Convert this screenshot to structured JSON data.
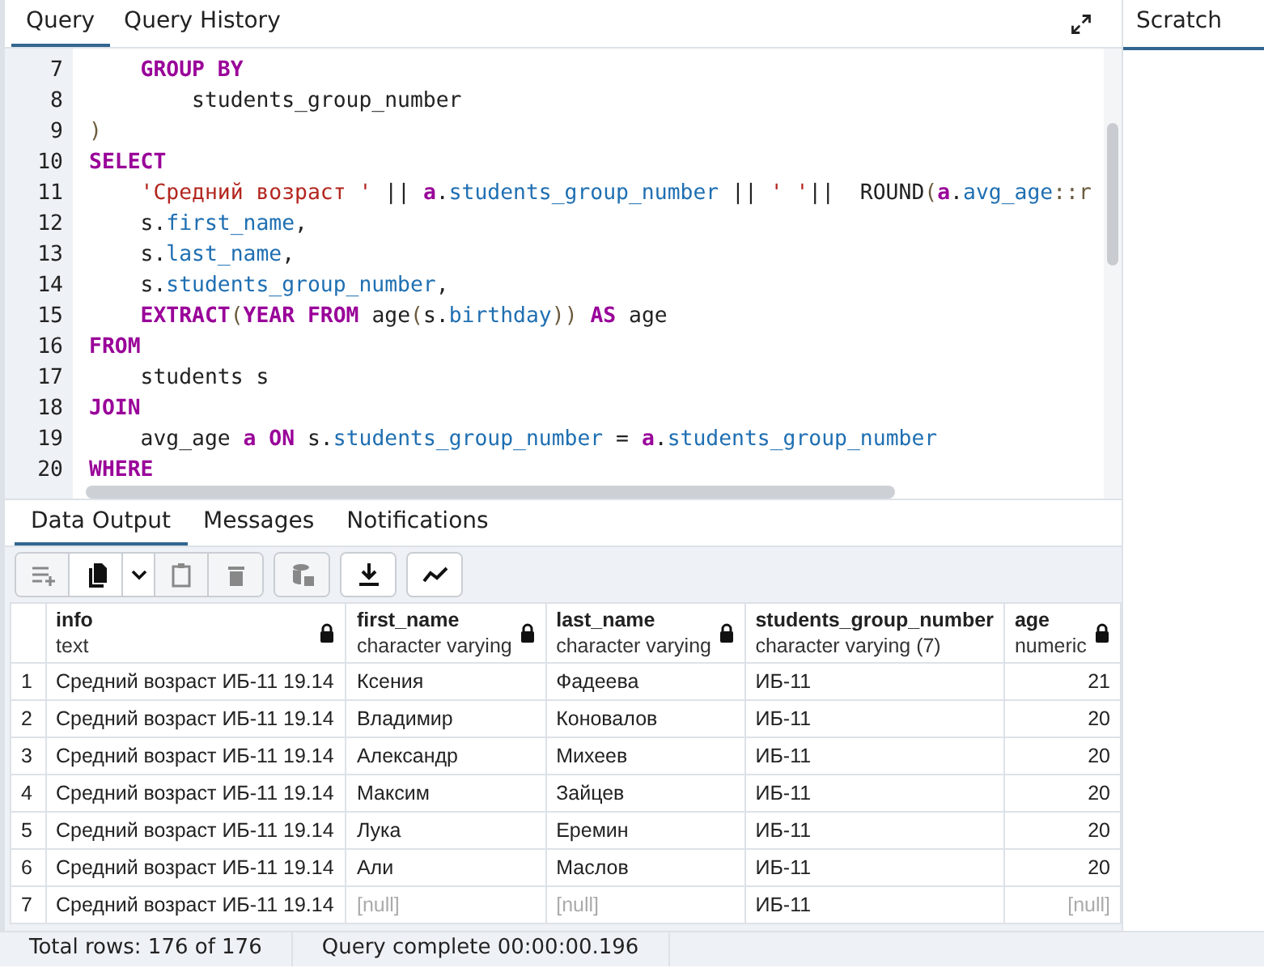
{
  "query_tabs": [
    {
      "label": "Query",
      "selected": true
    },
    {
      "label": "Query History",
      "selected": false
    }
  ],
  "scratch_pad": {
    "title": "Scratch"
  },
  "editor": {
    "lines": [
      {
        "number": "7",
        "kind": "body",
        "tokens": [
          {
            "kind": "keyword",
            "text": "GROUP BY"
          }
        ]
      },
      {
        "number": "8",
        "kind": "nested",
        "tokens": [
          {
            "kind": "plain",
            "text": "students_group_number"
          }
        ]
      },
      {
        "number": "9",
        "kind": "top",
        "tokens": [
          {
            "kind": "punct",
            "text": ")"
          }
        ]
      },
      {
        "number": "10",
        "kind": "top",
        "tokens": [
          {
            "kind": "keyword",
            "text": "SELECT"
          }
        ]
      },
      {
        "number": "11",
        "kind": "body",
        "tokens": [
          {
            "kind": "string",
            "text": "'Средний возраст '"
          },
          {
            "kind": "plain",
            "text": " || "
          },
          {
            "kind": "keyword",
            "text": "a"
          },
          {
            "kind": "plain",
            "text": "."
          },
          {
            "kind": "field",
            "text": "students_group_number"
          },
          {
            "kind": "plain",
            "text": " || "
          },
          {
            "kind": "string",
            "text": "' '"
          },
          {
            "kind": "plain",
            "text": "||  ROUND"
          },
          {
            "kind": "punct",
            "text": "("
          },
          {
            "kind": "keyword",
            "text": "a"
          },
          {
            "kind": "plain",
            "text": "."
          },
          {
            "kind": "field",
            "text": "avg_age"
          },
          {
            "kind": "punct",
            "text": "::r"
          }
        ]
      },
      {
        "number": "12",
        "kind": "body",
        "tokens": [
          {
            "kind": "plain",
            "text": "s."
          },
          {
            "kind": "field",
            "text": "first_name"
          },
          {
            "kind": "plain",
            "text": ","
          }
        ]
      },
      {
        "number": "13",
        "kind": "body",
        "tokens": [
          {
            "kind": "plain",
            "text": "s."
          },
          {
            "kind": "field",
            "text": "last_name"
          },
          {
            "kind": "plain",
            "text": ","
          }
        ]
      },
      {
        "number": "14",
        "kind": "body",
        "tokens": [
          {
            "kind": "plain",
            "text": "s."
          },
          {
            "kind": "field",
            "text": "students_group_number"
          },
          {
            "kind": "plain",
            "text": ","
          }
        ]
      },
      {
        "number": "15",
        "kind": "body",
        "tokens": [
          {
            "kind": "keyword",
            "text": "EXTRACT"
          },
          {
            "kind": "punct",
            "text": "("
          },
          {
            "kind": "keyword",
            "text": "YEAR FROM"
          },
          {
            "kind": "plain",
            "text": " age"
          },
          {
            "kind": "punct",
            "text": "("
          },
          {
            "kind": "plain",
            "text": "s."
          },
          {
            "kind": "field",
            "text": "birthday"
          },
          {
            "kind": "punct",
            "text": "))"
          },
          {
            "kind": "keyword",
            "text": " AS"
          },
          {
            "kind": "plain",
            "text": " age"
          }
        ]
      },
      {
        "number": "16",
        "kind": "top",
        "tokens": [
          {
            "kind": "keyword",
            "text": "FROM"
          }
        ]
      },
      {
        "number": "17",
        "kind": "body",
        "tokens": [
          {
            "kind": "plain",
            "text": "students s"
          }
        ]
      },
      {
        "number": "18",
        "kind": "top",
        "tokens": [
          {
            "kind": "keyword",
            "text": "JOIN"
          }
        ]
      },
      {
        "number": "19",
        "kind": "body",
        "tokens": [
          {
            "kind": "plain",
            "text": "avg_age "
          },
          {
            "kind": "keyword",
            "text": "a ON"
          },
          {
            "kind": "plain",
            "text": " s."
          },
          {
            "kind": "field",
            "text": "students_group_number"
          },
          {
            "kind": "plain",
            "text": " = "
          },
          {
            "kind": "keyword",
            "text": "a"
          },
          {
            "kind": "plain",
            "text": "."
          },
          {
            "kind": "field",
            "text": "students_group_number"
          }
        ]
      },
      {
        "number": "20",
        "kind": "top",
        "tokens": [
          {
            "kind": "keyword",
            "text": "WHERE"
          }
        ]
      }
    ]
  },
  "output_tabs": [
    {
      "label": "Data Output",
      "selected": true
    },
    {
      "label": "Messages",
      "selected": false
    },
    {
      "label": "Notifications",
      "selected": false
    }
  ],
  "toolbar": [
    {
      "kind": "add-row",
      "disabled": true,
      "group_start": true
    },
    {
      "kind": "copy",
      "disabled": false,
      "group_start": false
    },
    {
      "kind": "caret",
      "disabled": false,
      "group_start": false
    },
    {
      "kind": "paste",
      "disabled": true,
      "group_start": false
    },
    {
      "kind": "delete",
      "disabled": true,
      "group_start": false
    },
    {
      "kind": "save-data",
      "disabled": true,
      "group_start": true
    },
    {
      "kind": "download",
      "disabled": false,
      "group_start": true
    },
    {
      "kind": "graph",
      "disabled": false,
      "group_start": true
    }
  ],
  "table": {
    "columns": [
      {
        "name": "info",
        "type": "text",
        "locked": true,
        "kind": "text"
      },
      {
        "name": "first_name",
        "type": "character varying",
        "locked": true,
        "kind": "text"
      },
      {
        "name": "last_name",
        "type": "character varying",
        "locked": true,
        "kind": "text"
      },
      {
        "name": "students_group_number",
        "type": "character varying (7)",
        "locked": false,
        "kind": "text"
      },
      {
        "name": "age",
        "type": "numeric",
        "locked": true,
        "kind": "number"
      }
    ],
    "rows": [
      {
        "number": "1",
        "cells": [
          {
            "value": "Средний возраст ИБ-11 19.14",
            "null": false
          },
          {
            "value": "Ксения",
            "null": false
          },
          {
            "value": "Фадеева",
            "null": false
          },
          {
            "value": "ИБ-11",
            "null": false
          },
          {
            "value": "21",
            "null": false
          }
        ]
      },
      {
        "number": "2",
        "cells": [
          {
            "value": "Средний возраст ИБ-11 19.14",
            "null": false
          },
          {
            "value": "Владимир",
            "null": false
          },
          {
            "value": "Коновалов",
            "null": false
          },
          {
            "value": "ИБ-11",
            "null": false
          },
          {
            "value": "20",
            "null": false
          }
        ]
      },
      {
        "number": "3",
        "cells": [
          {
            "value": "Средний возраст ИБ-11 19.14",
            "null": false
          },
          {
            "value": "Александр",
            "null": false
          },
          {
            "value": "Михеев",
            "null": false
          },
          {
            "value": "ИБ-11",
            "null": false
          },
          {
            "value": "20",
            "null": false
          }
        ]
      },
      {
        "number": "4",
        "cells": [
          {
            "value": "Средний возраст ИБ-11 19.14",
            "null": false
          },
          {
            "value": "Максим",
            "null": false
          },
          {
            "value": "Зайцев",
            "null": false
          },
          {
            "value": "ИБ-11",
            "null": false
          },
          {
            "value": "20",
            "null": false
          }
        ]
      },
      {
        "number": "5",
        "cells": [
          {
            "value": "Средний возраст ИБ-11 19.14",
            "null": false
          },
          {
            "value": "Лука",
            "null": false
          },
          {
            "value": "Еремин",
            "null": false
          },
          {
            "value": "ИБ-11",
            "null": false
          },
          {
            "value": "20",
            "null": false
          }
        ]
      },
      {
        "number": "6",
        "cells": [
          {
            "value": "Средний возраст ИБ-11 19.14",
            "null": false
          },
          {
            "value": "Али",
            "null": false
          },
          {
            "value": "Маслов",
            "null": false
          },
          {
            "value": "ИБ-11",
            "null": false
          },
          {
            "value": "20",
            "null": false
          }
        ]
      },
      {
        "number": "7",
        "cells": [
          {
            "value": "Средний возраст ИБ-11 19.14",
            "null": false
          },
          {
            "value": "[null]",
            "null": true
          },
          {
            "value": "[null]",
            "null": true
          },
          {
            "value": "ИБ-11",
            "null": false
          },
          {
            "value": "[null]",
            "null": true
          }
        ]
      }
    ]
  },
  "status_bar": [
    "Total rows: 176 of 176",
    "Query complete 00:00:00.196"
  ]
}
